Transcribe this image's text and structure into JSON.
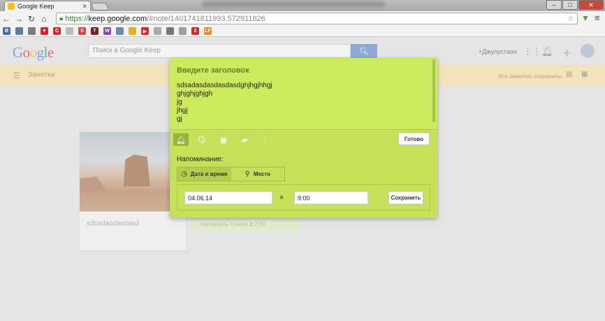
{
  "browser": {
    "tab_title": "Google Keep",
    "url_https": "https://",
    "url_host": "keep.google.com",
    "url_path": "/#note/1401741811993.572911826",
    "bookmarks": [
      {
        "icon": "vk-icon",
        "color": "#4a6f9c",
        "glyph": "В"
      },
      {
        "icon": "app-icon",
        "color": "#5f7e8f",
        "glyph": ""
      },
      {
        "icon": "grid-icon",
        "color": "#7b7b7b",
        "glyph": ""
      },
      {
        "icon": "heart-icon",
        "color": "#d6203b",
        "glyph": "♥"
      },
      {
        "icon": "ccm-icon",
        "color": "#c8312a",
        "glyph": "C"
      },
      {
        "icon": "page-icon",
        "color": "#bbbbbb",
        "glyph": ""
      },
      {
        "icon": "s-icon",
        "color": "#d24a3d",
        "glyph": "S"
      },
      {
        "icon": "tl-icon",
        "color": "#7a2020",
        "glyph": "T"
      },
      {
        "icon": "w-icon",
        "color": "#8a4aa6",
        "glyph": "W"
      },
      {
        "icon": "doc-icon",
        "color": "#6c8bb2",
        "glyph": ""
      },
      {
        "icon": "bee-icon",
        "color": "#e0b21e",
        "glyph": ""
      },
      {
        "icon": "youtube-icon",
        "color": "#d32828",
        "glyph": "▶"
      },
      {
        "icon": "page2-icon",
        "color": "#aaaaaa",
        "glyph": ""
      },
      {
        "icon": "apple-icon",
        "color": "#777777",
        "glyph": ""
      },
      {
        "icon": "list-icon",
        "color": "#a0a0a0",
        "glyph": ""
      },
      {
        "icon": "two-icon",
        "color": "#c72b2b",
        "glyph": "2"
      },
      {
        "icon": "lf-icon",
        "color": "#e58b2e",
        "glyph": "LF"
      }
    ]
  },
  "header": {
    "logo": [
      "G",
      "o",
      "o",
      "g",
      "l",
      "e"
    ],
    "logo_colors": [
      "#3369e8",
      "#d50f25",
      "#eeb211",
      "#3369e8",
      "#009925",
      "#d50f25"
    ],
    "search_placeholder": "Поиск в Google Keep",
    "user_link": "+Джулустаан"
  },
  "subbar": {
    "notes_label": "Заметки",
    "saved_status": "Все заметки сохранены"
  },
  "background_note": {
    "title": "sdsadasdasdasd",
    "reminder": "Напомнить 4 июня в 2:00"
  },
  "dialog": {
    "heading_placeholder": "Введите заголовок",
    "body_lines": [
      "sdsadasdasdasdasdghjhgjhhgj",
      "ghjghjghjgh",
      "jg",
      "jhgj",
      "gj"
    ],
    "done_label": "Готово",
    "reminder_label": "Напоминание:",
    "tab_datetime": "Дата и время",
    "tab_place": "Место",
    "date_value": "04.06.14",
    "at_label": "в",
    "time_value": "9:00",
    "save_label": "Сохранить"
  }
}
